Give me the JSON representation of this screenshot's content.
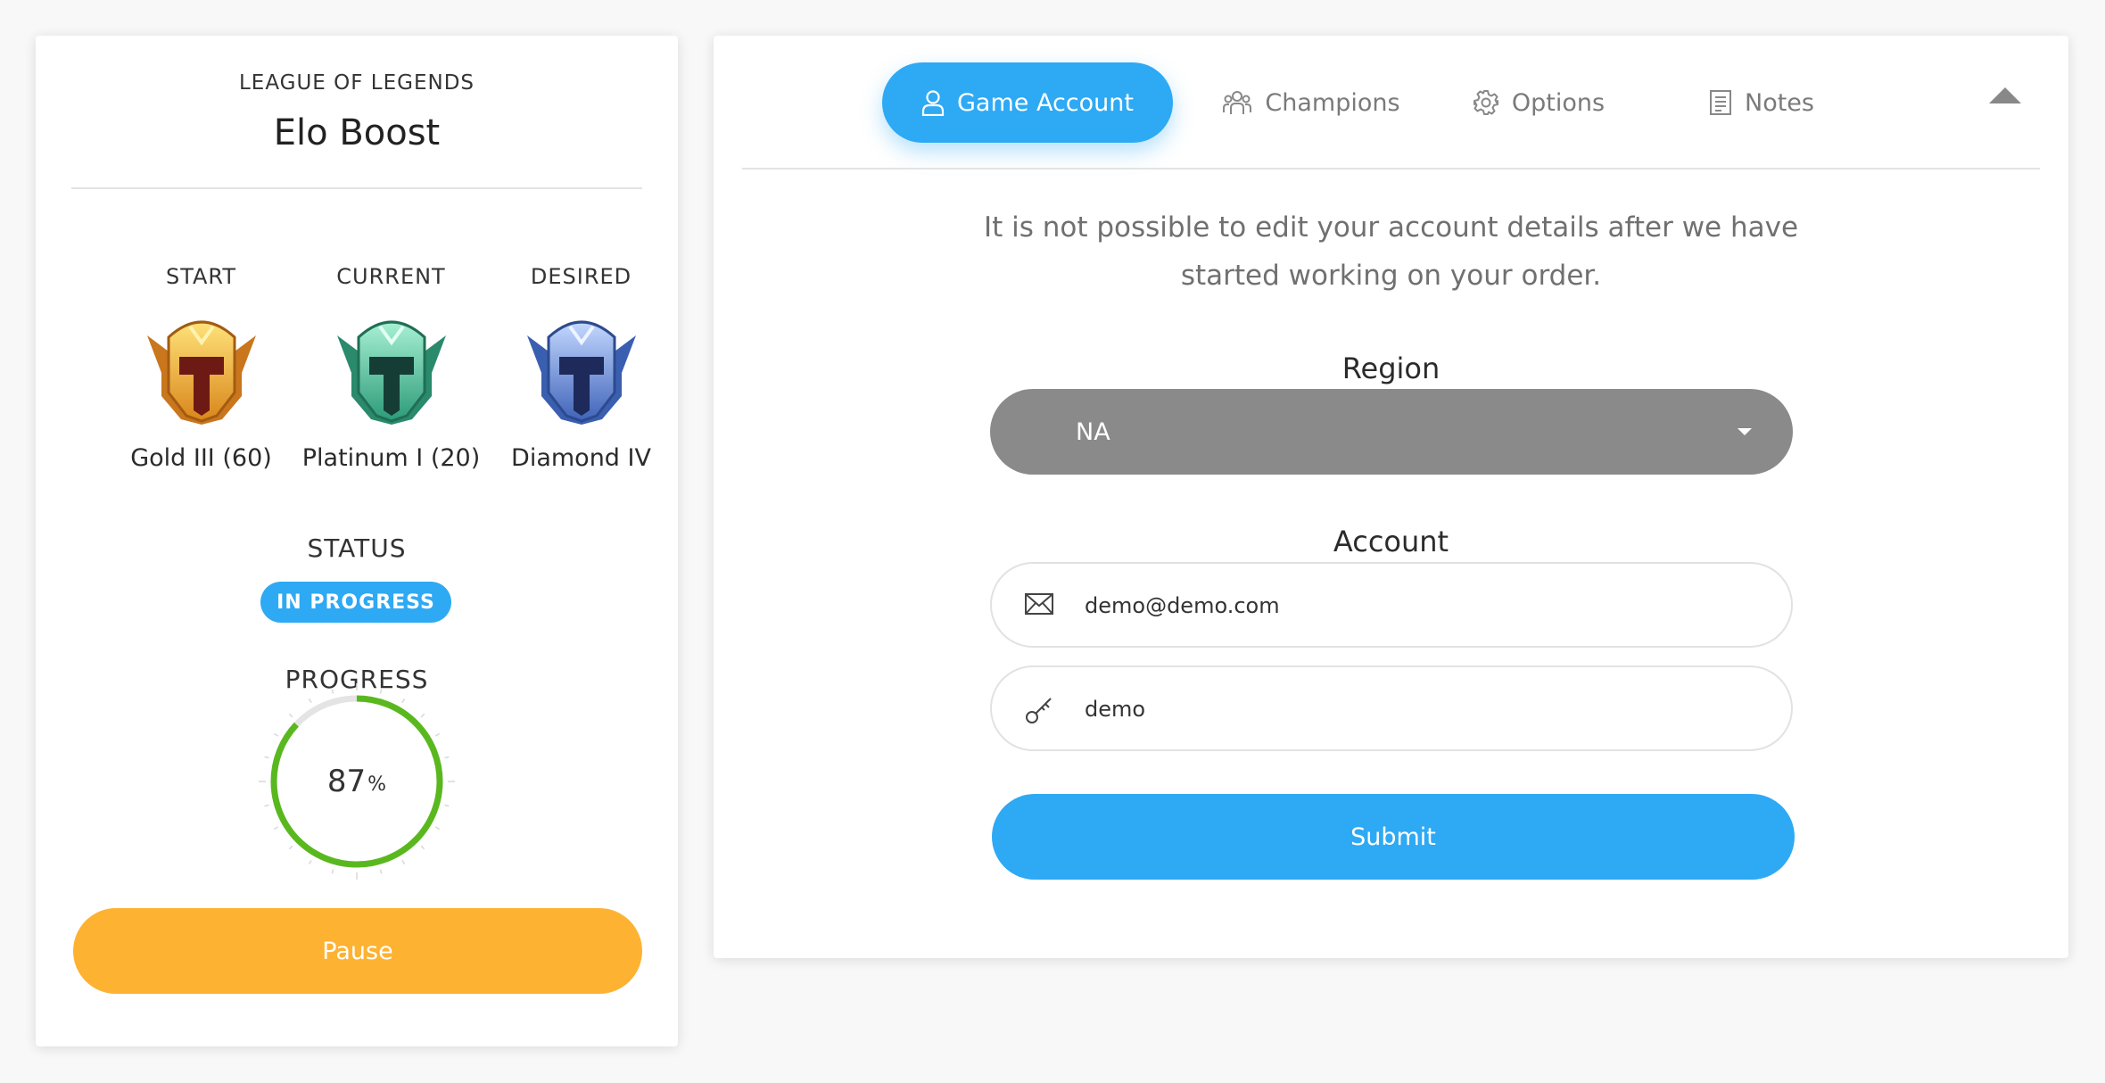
{
  "order": {
    "game": "LEAGUE OF LEGENDS",
    "service": "Elo Boost",
    "ranks": [
      {
        "heading": "START",
        "name": "Gold III (60)",
        "emblem": "gold-rank-emblem-icon",
        "color": "#f3b12c"
      },
      {
        "heading": "CURRENT",
        "name": "Platinum I (20)",
        "emblem": "platinum-rank-emblem-icon",
        "color": "#4fc39a"
      },
      {
        "heading": "DESIRED",
        "name": "Diamond IV",
        "emblem": "diamond-rank-emblem-icon",
        "color": "#5b86d6"
      }
    ],
    "status_label": "STATUS",
    "status": "IN PROGRESS",
    "progress_label": "PROGRESS",
    "progress_value": "87",
    "progress_unit": "%",
    "progress_fraction": 0.87,
    "pause_label": "Pause"
  },
  "tabs": [
    {
      "label": "Game Account",
      "icon": "user-icon",
      "active": true
    },
    {
      "label": "Champions",
      "icon": "users-group-icon",
      "active": false
    },
    {
      "label": "Options",
      "icon": "gear-icon",
      "active": false
    },
    {
      "label": "Notes",
      "icon": "document-icon",
      "active": false
    }
  ],
  "collapse_icon": "chevron-up-icon",
  "form": {
    "notice": "It is not possible to edit your account details after we have started working on your order.",
    "region_label": "Region",
    "region_value": "NA",
    "account_label": "Account",
    "email_value": "demo@demo.com",
    "password_value": "demo",
    "submit_label": "Submit"
  },
  "colors": {
    "accent": "#2ea9f4",
    "pause": "#fdb232",
    "progress": "#5ab81f",
    "select": "#8a8a8a"
  }
}
